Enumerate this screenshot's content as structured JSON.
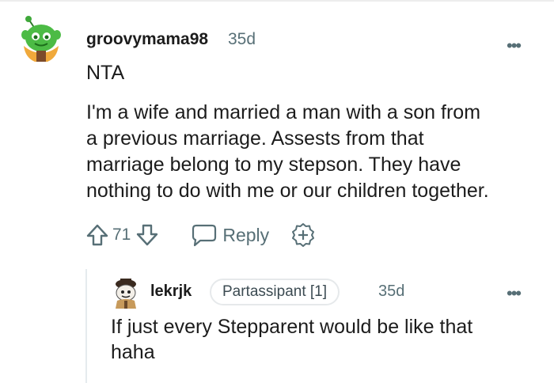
{
  "comment": {
    "username": "groovymama98",
    "time": "35d",
    "more_label": "•••",
    "body_lines": [
      "NTA",
      "I'm a wife and married a man with a son from",
      "a previous marriage. Assests from that",
      "marriage belong to my stepson. They have",
      "nothing to do with me or our children together."
    ],
    "vote_count": "71",
    "reply_label": "Reply",
    "icons": [
      "upvote-icon",
      "downvote-icon",
      "reply-bubble-icon",
      "award-plus-icon",
      "more-icon"
    ]
  },
  "reply": {
    "username": "lekrjk",
    "flair": "Partassipant [1]",
    "time": "35d",
    "more_label": "•••",
    "body_lines": [
      "If just every Stepparent would be like that",
      "haha"
    ]
  },
  "colors": {
    "text": "#1c1c1c",
    "meta": "#576f76",
    "thread_line": "#e5ebee",
    "avatar_green": "#3fa83a",
    "avatar_hair": "#f0a93b"
  }
}
